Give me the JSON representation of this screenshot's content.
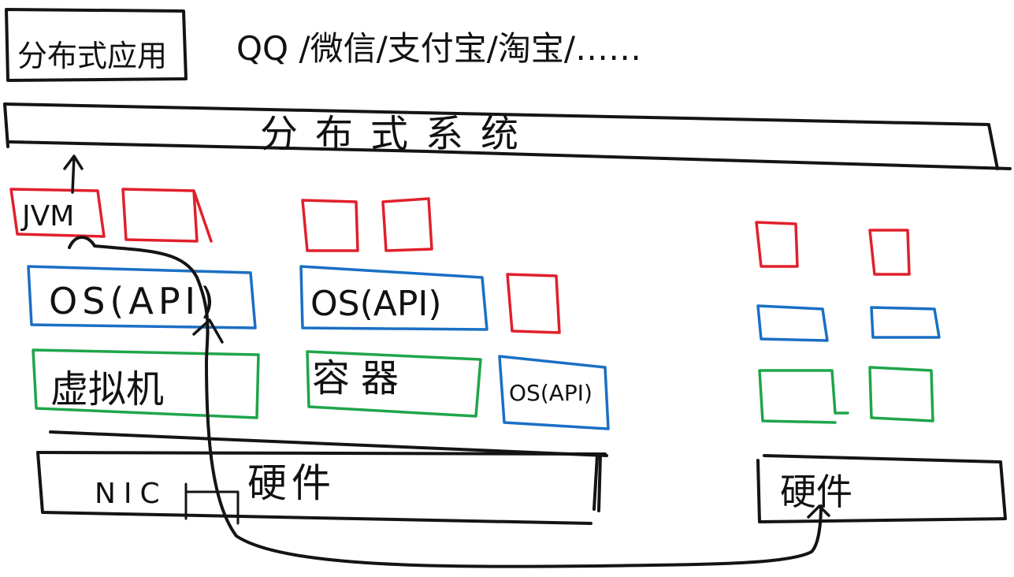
{
  "top": {
    "app_box_label": "分布式应用",
    "apps_label": "QQ /微信/支付宝/淘宝/……"
  },
  "system_bar": {
    "label": "分布式系统"
  },
  "left_stack": {
    "jvm_label": "JVM",
    "os_label": "OS(API)",
    "vm_label": "虚拟机"
  },
  "middle_stack": {
    "os_label": "OS(API)",
    "container_label": "容器",
    "os_small_label": "OS(API)"
  },
  "hardware": {
    "left_label": "硬件",
    "nic_label": "NIC",
    "right_label": "硬件"
  },
  "colors": {
    "app_layer": "#e0202c",
    "os_layer": "#1a6fc4",
    "virtualization_layer": "#1fa54a",
    "ink": "#141414"
  }
}
